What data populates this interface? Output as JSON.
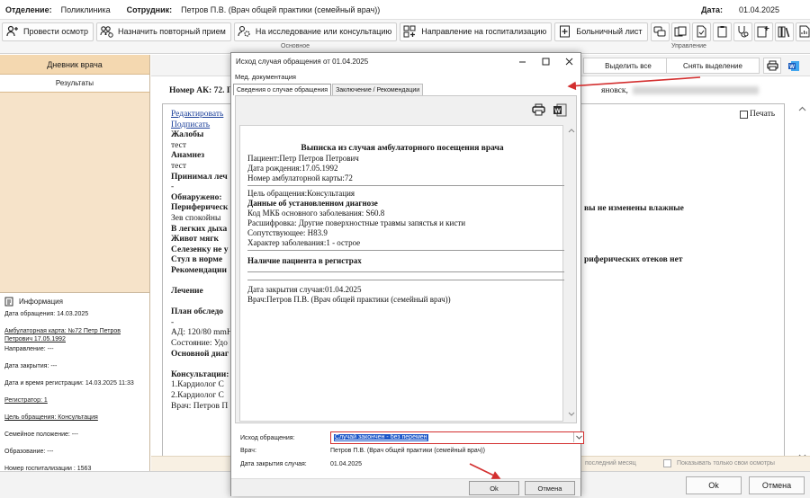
{
  "topbar": {
    "department_label": "Отделение:",
    "department_value": "Поликлиника",
    "employee_label": "Сотрудник:",
    "employee_value": "Петров П.В. (Врач общей практики (семейный врач))",
    "date_label": "Дата:",
    "date_value": "01.04.2025"
  },
  "ribbon": {
    "buttons": [
      {
        "label": "Провести осмотр",
        "icon": "user-plus-icon"
      },
      {
        "label": "Назначить повторный прием",
        "icon": "users-add-icon"
      },
      {
        "label": "На исследование или консультацию",
        "icon": "user-gear-icon"
      },
      {
        "label": "Направление на госпитализацию",
        "icon": "hospital-referral-icon"
      },
      {
        "label": "Больничный лист",
        "icon": "sick-leave-icon"
      }
    ],
    "group_main": "Основное",
    "group_manage": "Управление"
  },
  "left": {
    "header": "Дневник врача",
    "tab": "Результаты",
    "info_title": "Информация",
    "info": {
      "visit_date": "Дата обращения: 14.03.2025",
      "card": "Амбулаторная карта: №72 Петр Петров Петрович 17.05.1992",
      "referral": "Направление: ---",
      "close_date": "Дата закрытия: ---",
      "reg_datetime": "Дата и время регистрации: 14.03.2025 11:33",
      "registrar": "Регистратор: 1",
      "goal": "Цель обращения: Консультация",
      "family": "Семейное положение: ---",
      "education": "Образование: ---",
      "hosp_no": "Номер госпитализации : 1563"
    }
  },
  "main": {
    "select_all": "Выделить все",
    "deselect": "Снять выделение",
    "card_no": "Номер АК: 72. П",
    "city": "яновск,",
    "print_label": "Печать",
    "lines": [
      {
        "t": "Редактировать",
        "c": "a"
      },
      {
        "t": "Подписать",
        "c": "a"
      },
      {
        "t": "Жалобы",
        "c": "b"
      },
      {
        "t": "тест",
        "c": ""
      },
      {
        "t": "Анамнез",
        "c": "b"
      },
      {
        "t": "тест",
        "c": ""
      },
      {
        "t": "Принимал леч",
        "c": "b"
      },
      {
        "t": "-",
        "c": ""
      },
      {
        "t": "Обнаружено:",
        "c": "b"
      },
      {
        "t": "Периферическ",
        "c": "b"
      },
      {
        "t": "Зев  спокойны",
        "c": ""
      },
      {
        "t": "В легких дыха",
        "c": "b"
      },
      {
        "t": "Живот    мягк",
        "c": "b"
      },
      {
        "t": "Селезенку не у",
        "c": "b"
      },
      {
        "t": "Стул в норме",
        "c": "b"
      },
      {
        "t": "Рекомендации",
        "c": "b"
      },
      {
        "t": "",
        "c": ""
      },
      {
        "t": "Лечение",
        "c": "b"
      },
      {
        "t": "",
        "c": ""
      },
      {
        "t": "План обследо",
        "c": "b"
      },
      {
        "t": "-",
        "c": ""
      },
      {
        "t": "АД: 120/80 mmH",
        "c": ""
      },
      {
        "t": "Состояние: Удо",
        "c": ""
      },
      {
        "t": "Основной диаг",
        "c": "b"
      },
      {
        "t": "",
        "c": ""
      },
      {
        "t": "Консультации:",
        "c": "b"
      },
      {
        "t": "  1.Кардиолог С",
        "c": ""
      },
      {
        "t": "  2.Кардиолог С",
        "c": ""
      },
      {
        "t": "Врач: Петров П",
        "c": ""
      }
    ],
    "right1": "вы не изменены влажные",
    "right2": "риферических отеков нет",
    "bottom_hint1": "последний месяц",
    "bottom_hint2": "Показывать только свои осмотры"
  },
  "footer": {
    "ok": "Ok",
    "cancel": "Отмена"
  },
  "dialog": {
    "title": "Исход случая обращения от 01.04.2025",
    "menu": "Мед. документация",
    "tab1": "Сведения о случае обращения",
    "tab2": "Заключение / Рекомендации",
    "doc": {
      "title": "Выписка из случая амбулаторного посещения врача",
      "patient": "Пациент:Петр Петров Петрович",
      "dob": "Дата рождения:17.05.1992",
      "card": "Номер амбулаторной карты:72",
      "goal": "Цель обращения:Консультация",
      "diag_header": "Данные об установленном диагнозе",
      "mkb": "Код МКБ основного заболевания: S60.8",
      "decode": "Расшифровка: Другие поверхностные травмы запястья и кисти",
      "concomitant": "Сопутствующее: H83.9",
      "character": "Характер заболевания:1 - острое",
      "registry": "Наличие пациента в регистрах",
      "close_date": "Дата закрытия случая:01.04.2025",
      "doctor": "Врач:Петров П.В. (Врач общей практики (семейный врач))"
    },
    "fields": {
      "outcome_label": "Исход обращения:",
      "outcome_value": "Случай закончен - без перемен",
      "doctor_label": "Врач:",
      "doctor_value": "Петров П.В. (Врач общей практики (семейный врач))",
      "close_label": "Дата закрытия случая:",
      "close_value": "01.04.2025"
    },
    "ok": "Ok",
    "cancel": "Отмена"
  },
  "colors": {
    "accent_red": "#d32f2f",
    "selection_blue": "#1c56c8",
    "left_panel": "#f6e3c9"
  }
}
